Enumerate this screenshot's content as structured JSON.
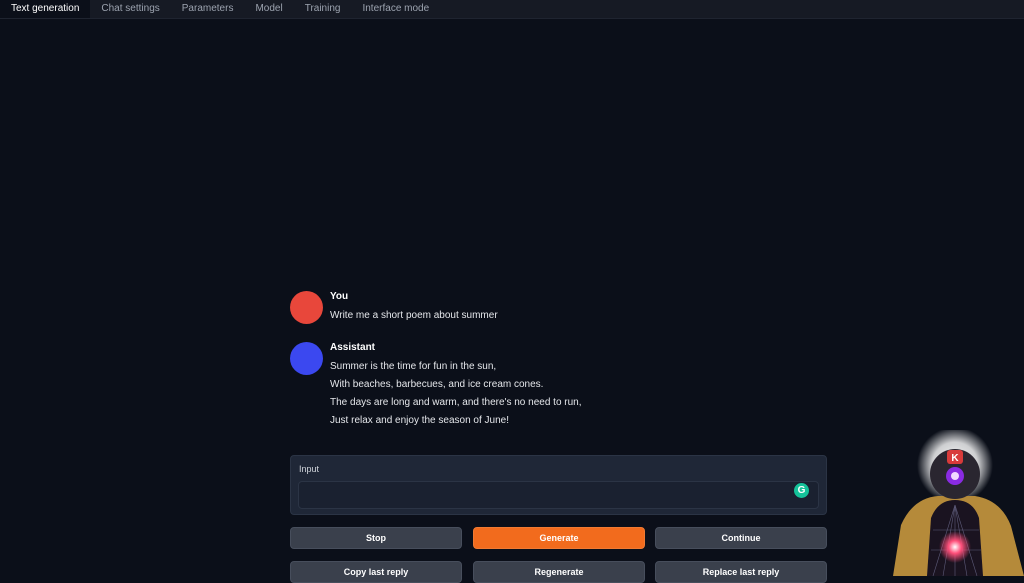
{
  "tabs": [
    {
      "label": "Text generation",
      "active": true
    },
    {
      "label": "Chat settings",
      "active": false
    },
    {
      "label": "Parameters",
      "active": false
    },
    {
      "label": "Model",
      "active": false
    },
    {
      "label": "Training",
      "active": false
    },
    {
      "label": "Interface mode",
      "active": false
    }
  ],
  "chat": {
    "messages": [
      {
        "role": "You",
        "avatar_color": "#e8473b",
        "lines": [
          "Write me a short poem about summer"
        ]
      },
      {
        "role": "Assistant",
        "avatar_color": "#3b48f0",
        "lines": [
          "Summer is the time for fun in the sun,",
          "With beaches, barbecues, and ice cream cones.",
          "The days are long and warm, and there's no need to run,",
          "Just relax and enjoy the season of June!"
        ]
      }
    ]
  },
  "input": {
    "label": "Input",
    "value": "",
    "grammarly_letter": "G"
  },
  "buttons": {
    "stop": "Stop",
    "generate": "Generate",
    "continue": "Continue",
    "copy_last_reply": "Copy last reply",
    "regenerate": "Regenerate",
    "replace_last_reply": "Replace last reply"
  },
  "webcam": {
    "badge_letter": "K"
  },
  "colors": {
    "background": "#0b0f19",
    "primary": "#f26b1d",
    "panel": "#1f2737"
  }
}
